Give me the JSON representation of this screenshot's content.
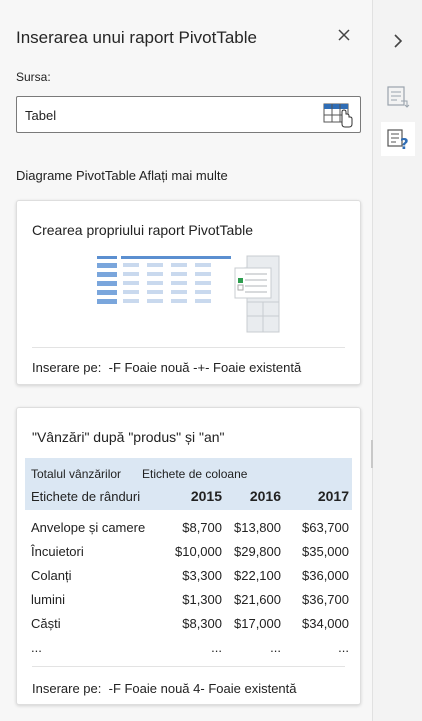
{
  "pane": {
    "title": "Inserarea unui raport PivotTable",
    "close_icon": "close-icon"
  },
  "source": {
    "label": "Sursa:",
    "value": "Tabel",
    "picker_icon": "table-range-picker-icon"
  },
  "suggestions": {
    "heading": "Diagrame PivotTable",
    "learn_more": "Aflați mai multe"
  },
  "card_custom": {
    "title": "Crearea propriului raport PivotTable",
    "insert_label": "Inserare pe:",
    "opt_new": "-F Foaie nouă",
    "opt_existing": "-+- Foaie existentă"
  },
  "card_suggested": {
    "title": "\"Vânzări\" după \"produs\" și \"an\"",
    "insert_label": "Inserare pe:",
    "opt_new": "-F Foaie nouă",
    "opt_existing": "4- Foaie existentă",
    "table": {
      "header_values": "Totalul vânzărilor",
      "header_columns": "Etichete de coloane",
      "header_rows": "Etichete de rânduri",
      "years": [
        "2015",
        "2016",
        "2017"
      ],
      "rows": [
        {
          "label": "Anvelope și camere",
          "values": [
            "$8,700",
            "$13,800",
            "$63,700"
          ]
        },
        {
          "label": "Încuietori",
          "values": [
            "$10,000",
            "$29,800",
            "$35,000"
          ]
        },
        {
          "label": "Colanți",
          "values": [
            "$3,300",
            "$22,100",
            "$36,000"
          ]
        },
        {
          "label": "lumini",
          "values": [
            "$1,300",
            "$21,600",
            "$36,700"
          ]
        },
        {
          "label": "Căști",
          "values": [
            "$8,300",
            "$17,000",
            "$34,000"
          ]
        },
        {
          "label": "...",
          "values": [
            "...",
            "...",
            "..."
          ]
        }
      ]
    }
  },
  "rail": {
    "expand_icon": "chevron-right-icon",
    "fields_icon": "field-list-icon",
    "suggest_icon": "pivot-help-icon"
  },
  "colors": {
    "accent": "#2f6db5",
    "header_fill": "#dbe7f3"
  }
}
